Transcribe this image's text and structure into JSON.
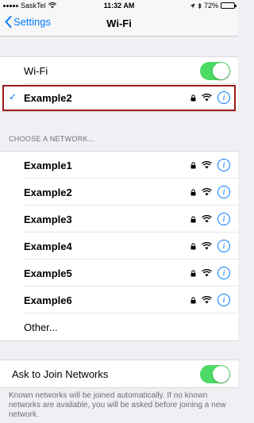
{
  "status_bar": {
    "carrier": "SaskTel",
    "time": "11:32 AM",
    "battery": "72%",
    "battery_level": 0.72
  },
  "nav": {
    "back_label": "Settings",
    "title": "Wi-Fi"
  },
  "wifi_toggle": {
    "label": "Wi-Fi",
    "on": true
  },
  "connected_network": {
    "name": "Example2",
    "secured": true
  },
  "choose_network_header": "CHOOSE A NETWORK...",
  "networks": [
    {
      "name": "Example1",
      "secured": true
    },
    {
      "name": "Example2",
      "secured": true
    },
    {
      "name": "Example3",
      "secured": true
    },
    {
      "name": "Example4",
      "secured": true
    },
    {
      "name": "Example5",
      "secured": true
    },
    {
      "name": "Example6",
      "secured": true
    }
  ],
  "other_label": "Other...",
  "ask_to_join": {
    "label": "Ask to Join Networks",
    "on": true,
    "footer": "Known networks will be joined automatically. If no known networks are available, you will be asked before joining a new network."
  },
  "icons": {
    "info": "info-icon",
    "lock": "lock-icon",
    "wifi": "wifi-signal-icon",
    "check": "checkmark-icon",
    "back": "chevron-left-icon"
  },
  "colors": {
    "accent": "#007aff",
    "toggle_on": "#4cd964",
    "background": "#efeff4",
    "highlight_border": "#9b1c1c"
  }
}
